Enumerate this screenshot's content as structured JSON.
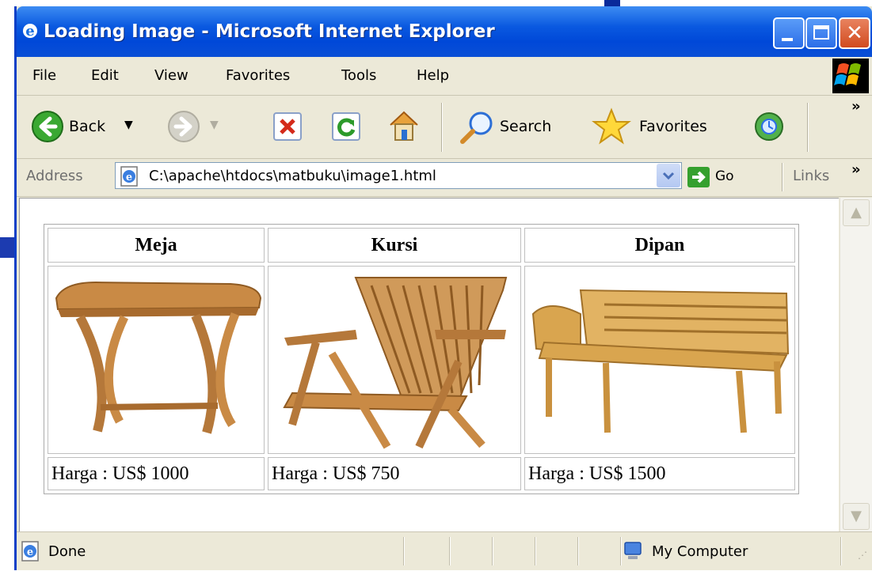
{
  "window": {
    "title": "Loading Image - Microsoft Internet Explorer"
  },
  "menu": {
    "items": [
      "File",
      "Edit",
      "View",
      "Favorites",
      "Tools",
      "Help"
    ]
  },
  "toolbar": {
    "back_label": "Back",
    "search_label": "Search",
    "favorites_label": "Favorites",
    "more": "»"
  },
  "address": {
    "label": "Address",
    "url": "C:\\apache\\htdocs\\matbuku\\image1.html",
    "go_label": "Go",
    "links_label": "Links",
    "more": "»"
  },
  "products": {
    "headers": [
      "Meja",
      "Kursi",
      "Dipan"
    ],
    "prices": [
      "Harga : US$ 1000",
      "Harga : US$ 750",
      "Harga : US$ 1500"
    ]
  },
  "status": {
    "text": "Done",
    "zone": "My Computer"
  },
  "colors": {
    "titlebar": "#0a59e0",
    "chrome": "#ece9d8",
    "wood": "#c98a45"
  }
}
